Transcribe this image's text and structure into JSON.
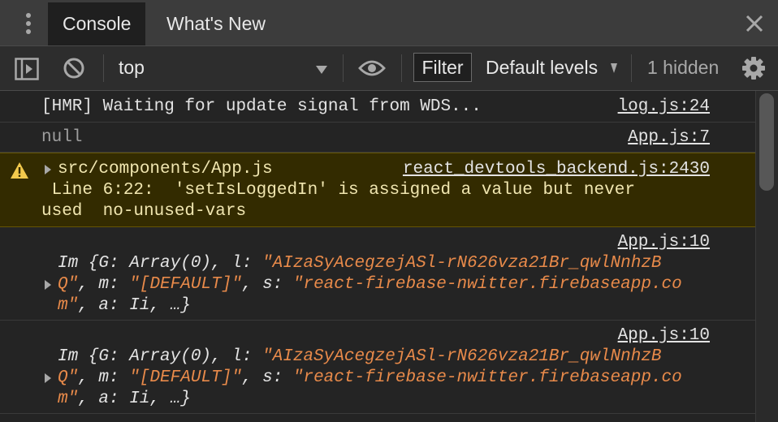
{
  "tabs": [
    {
      "label": "Console",
      "active": true
    },
    {
      "label": "What's New",
      "active": false
    }
  ],
  "toolbar": {
    "context": "top",
    "filter_placeholder": "Filter",
    "levels": "Default levels",
    "hidden": "1 hidden"
  },
  "messages": [
    {
      "type": "log",
      "text": "[HMR] Waiting for update signal from WDS...",
      "source": "log.js:24"
    },
    {
      "type": "log",
      "text": "null",
      "source": "App.js:7"
    },
    {
      "type": "warning",
      "text": "src/components/App.js",
      "detail_line1": " Line 6:22:  'setIsLoggedIn' is assigned a value but never",
      "detail_line2": "used  no-unused-vars",
      "source": "react_devtools_backend.js:2430"
    },
    {
      "type": "object",
      "source": "App.js:10",
      "l1_prefix": "Im {G: Array(0), l: ",
      "l1_str": "\"AIzaSyAcegzejASl-rN626vza21Br_qwlNnhzB",
      "l2_str_a": "Q\"",
      "l2_mid": ", m: ",
      "l2_str_b": "\"[DEFAULT]\"",
      "l2_mid2": ", s: ",
      "l2_str_c": "\"react-firebase-nwitter.firebaseapp.co",
      "l3_str": "m\"",
      "l3_rest": ", a: Ii, …}"
    },
    {
      "type": "object",
      "source": "App.js:10",
      "l1_prefix": "Im {G: Array(0), l: ",
      "l1_str": "\"AIzaSyAcegzejASl-rN626vza21Br_qwlNnhzB",
      "l2_str_a": "Q\"",
      "l2_mid": ", m: ",
      "l2_str_b": "\"[DEFAULT]\"",
      "l2_mid2": ", s: ",
      "l2_str_c": "\"react-firebase-nwitter.firebaseapp.co",
      "l3_str": "m\"",
      "l3_rest": ", a: Ii, …}"
    }
  ],
  "colors": {
    "warning_bg": "#332b00",
    "warning_icon": "#f2c94c",
    "string": "#e88a4a"
  },
  "icons": [
    "more-vert-icon",
    "close-icon",
    "sidebar-toggle-icon",
    "clear-console-icon",
    "dropdown-caret-icon",
    "eye-icon",
    "gear-icon",
    "warning-icon",
    "expand-arrow-icon"
  ]
}
